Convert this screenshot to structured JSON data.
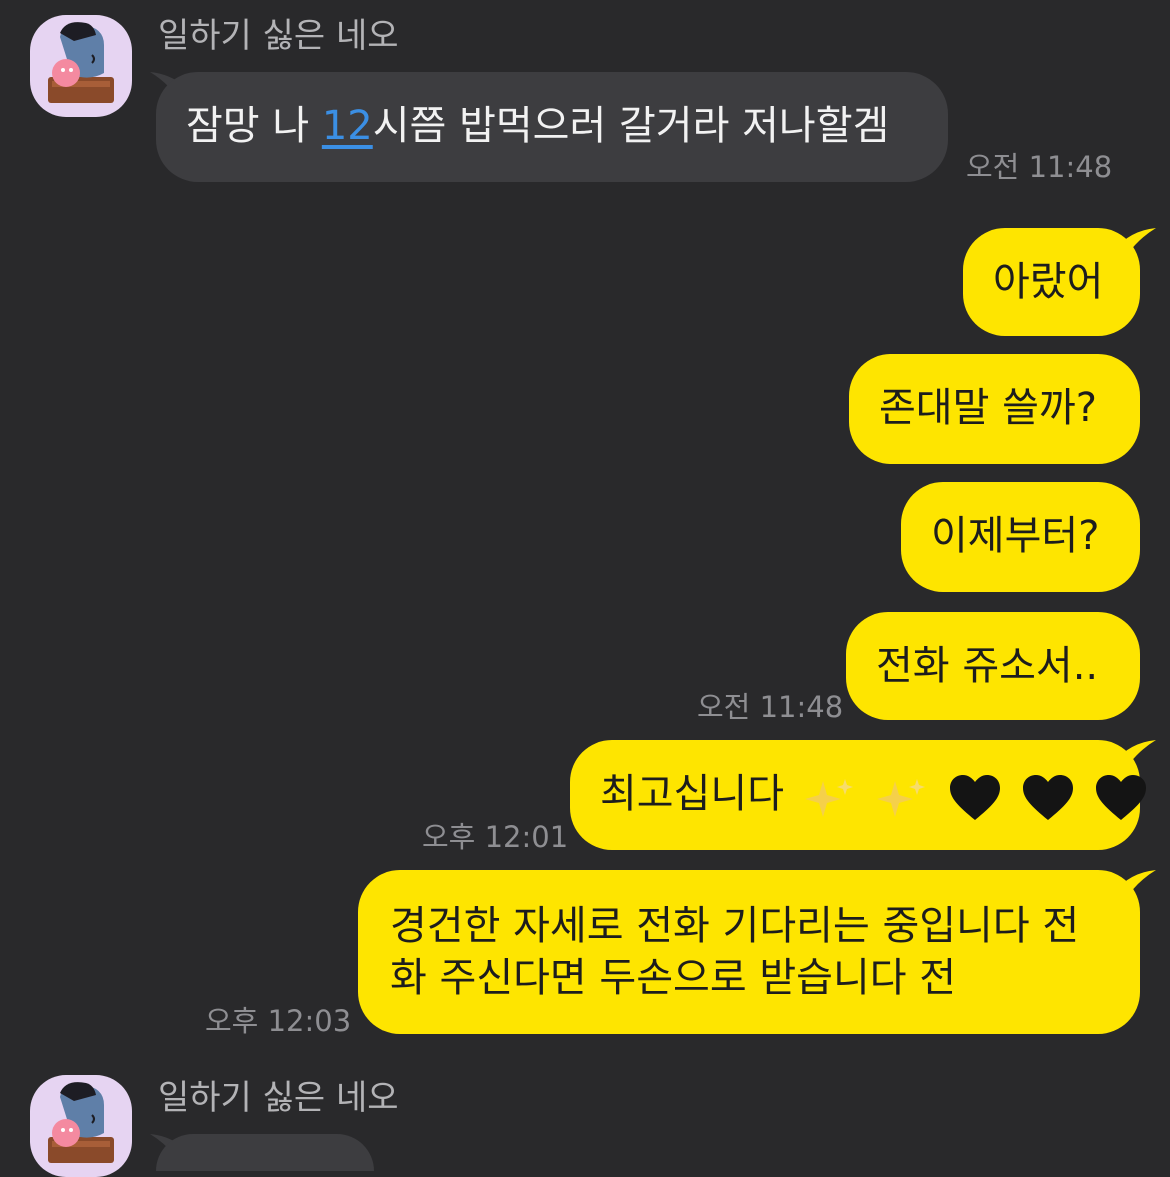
{
  "conversation": {
    "messages": [
      {
        "sender": "일하기 싫은 네오",
        "text_before": "잠망 나 ",
        "text_link": "12",
        "text_after": "시쯤 밥먹으러 갈거라 저나할겜",
        "time": "오전 11:48"
      },
      {
        "text": "아랐어"
      },
      {
        "text": "존대말 쓸까?"
      },
      {
        "text": "이제부터?"
      },
      {
        "text": "전화 쥬소서..",
        "time": "오전 11:48"
      },
      {
        "text": "최고십니다",
        "emojis": [
          "sparkles-emoji",
          "sparkles-emoji",
          "black-heart-emoji",
          "black-heart-emoji",
          "black-heart-emoji"
        ],
        "time": "오후 12:01"
      },
      {
        "line1": "경건한 자세로 전화 기다리는 중입니다 전",
        "line2": "화 주신다면 두손으로 받습니다 전",
        "time": "오후 12:03"
      },
      {
        "sender": "일하기 싫은 네오"
      }
    ]
  },
  "colors": {
    "background": "#29292b",
    "received_bubble": "#3d3d40",
    "sent_bubble": "#fee500",
    "link": "#3b8fe4",
    "avatar_bg": "#e6d4f2"
  },
  "icons": {
    "avatar": "neo-character-avatar-icon"
  }
}
